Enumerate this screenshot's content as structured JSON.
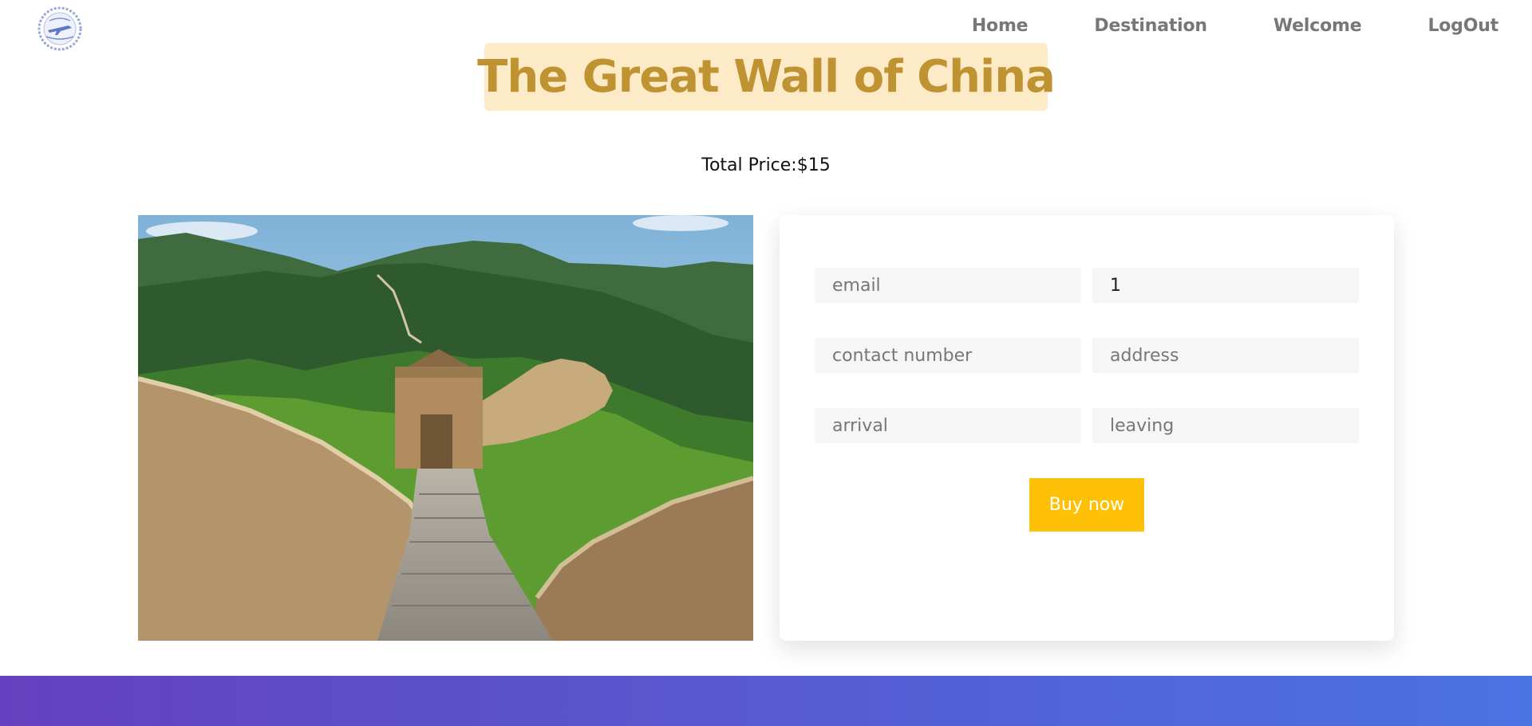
{
  "header": {
    "logo_icon": "travel-agency-seal-logo",
    "nav": {
      "home": "Home",
      "destination": "Destination",
      "welcome": "Welcome",
      "logout": "LogOut"
    }
  },
  "page": {
    "title": "The Great Wall of China",
    "total_price": "Total Price:$15"
  },
  "form": {
    "email": {
      "placeholder": "email",
      "value": ""
    },
    "quantity": {
      "placeholder": "",
      "value": "1"
    },
    "contact_number": {
      "placeholder": "contact number",
      "value": ""
    },
    "address": {
      "placeholder": "address",
      "value": ""
    },
    "arrival": {
      "placeholder": "arrival",
      "value": ""
    },
    "leaving": {
      "placeholder": "leaving",
      "value": ""
    },
    "buy_label": "Buy now"
  },
  "colors": {
    "title_bg": "#fdebc8",
    "title_text": "#bf9232",
    "button": "#ffc107",
    "footer_start": "#6441c0",
    "footer_end": "#4a73e2"
  }
}
